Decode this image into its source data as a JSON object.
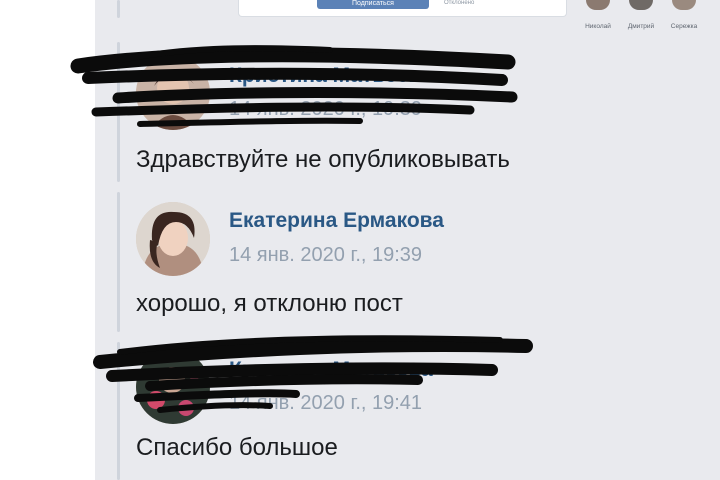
{
  "preview": {
    "button_label": "Подписаться",
    "note": "Отклонено"
  },
  "friends": [
    {
      "name": "Николай"
    },
    {
      "name": "Дмитрий"
    },
    {
      "name": "Сережка"
    }
  ],
  "comments": [
    {
      "author": "Кристина Матвеева",
      "time": "14 янв. 2020 г., 19:39",
      "text": "Здравствуйте не опубликовывать"
    },
    {
      "author": "Екатерина Ермакова",
      "time": "14 янв. 2020 г., 19:39",
      "text": "хорошо, я отклоню пост"
    },
    {
      "author": "Кристина Матвеева",
      "time": "14 янв. 2020 г., 19:41",
      "text": "Спасибо большое"
    }
  ],
  "colors": {
    "link": "#2a5885",
    "timestamp": "#93a0af",
    "panel_bg": "#e9eaee",
    "scribble": "#0b0b0b"
  }
}
